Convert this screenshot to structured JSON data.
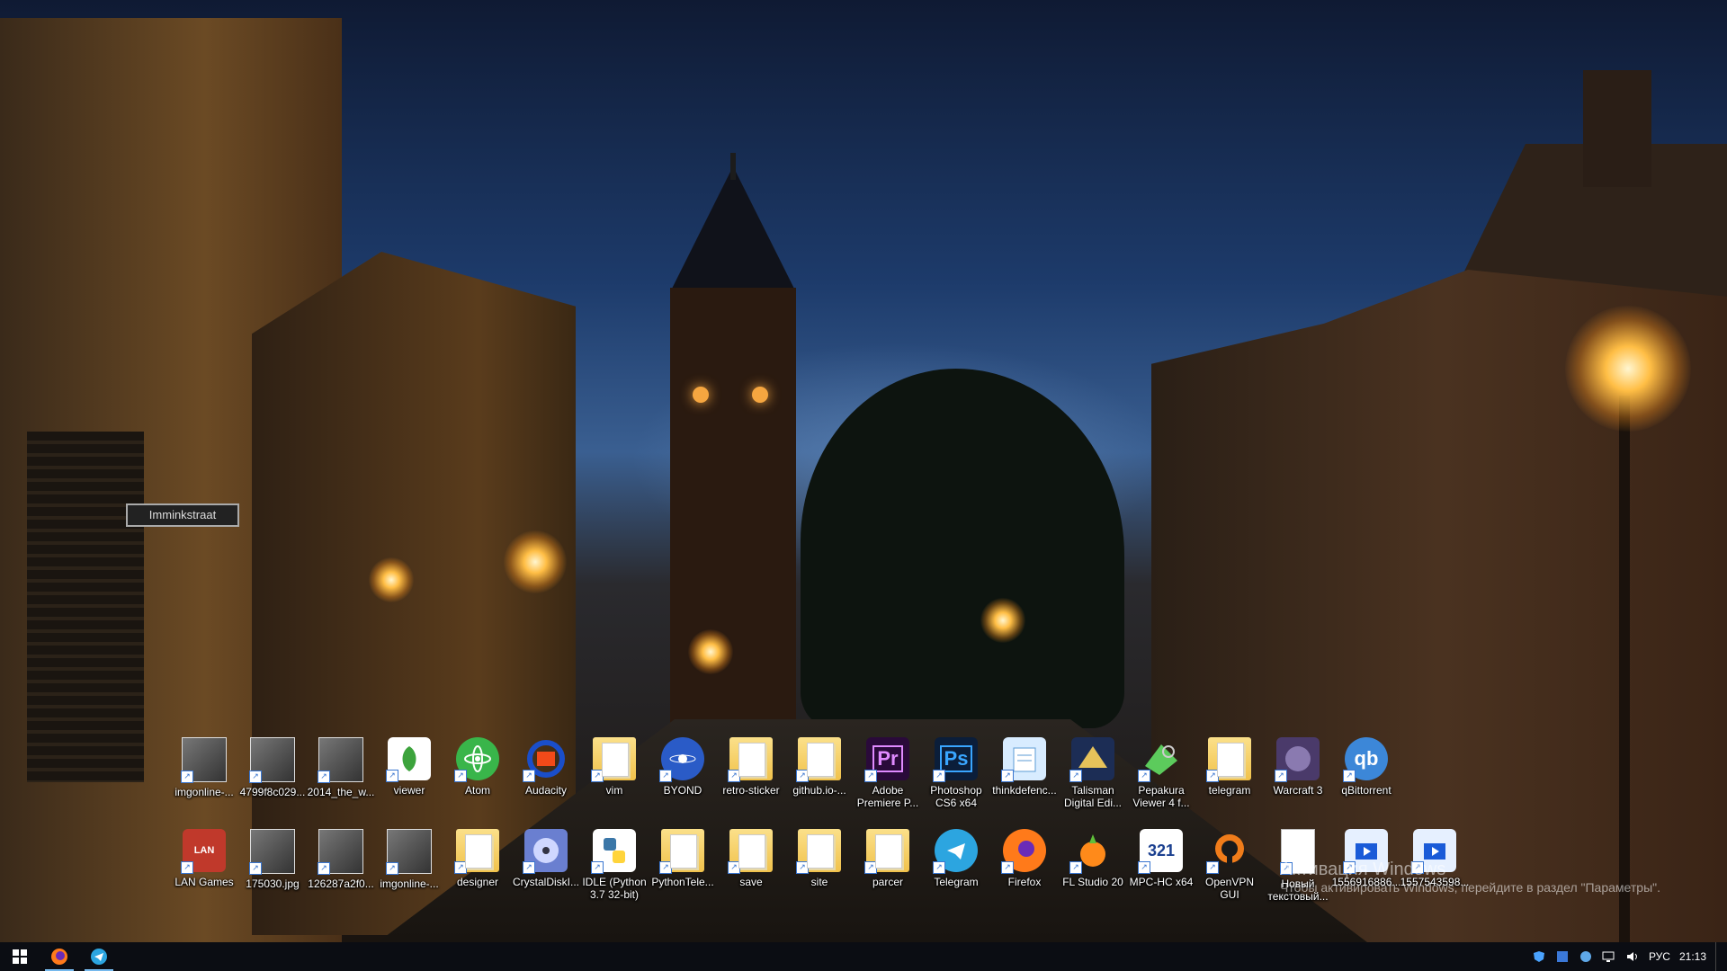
{
  "desktop": {
    "street_sign": "Imminkstraat",
    "row1": [
      {
        "label": "imgonline-...",
        "icon": "photo-icon"
      },
      {
        "label": "4799f8c029...",
        "icon": "photo-icon"
      },
      {
        "label": "2014_the_w...",
        "icon": "photo-icon"
      },
      {
        "label": "viewer",
        "icon": "viewer-app-icon"
      },
      {
        "label": "Atom",
        "icon": "atom-icon"
      },
      {
        "label": "Audacity",
        "icon": "audacity-icon"
      },
      {
        "label": "vim",
        "icon": "folder-icon"
      },
      {
        "label": "BYOND",
        "icon": "byond-icon"
      },
      {
        "label": "retro-sticker",
        "icon": "folder-icon"
      },
      {
        "label": "github.io-...",
        "icon": "folder-icon"
      },
      {
        "label": "Adobe Premiere P...",
        "icon": "premiere-icon"
      },
      {
        "label": "Photoshop CS6 x64",
        "icon": "photoshop-icon"
      },
      {
        "label": "thinkdefenc...",
        "icon": "notepad-icon"
      },
      {
        "label": "Talisman Digital Edi...",
        "icon": "talisman-icon"
      },
      {
        "label": "Pepakura Viewer 4 f...",
        "icon": "pepakura-icon"
      },
      {
        "label": "telegram",
        "icon": "folder-icon"
      },
      {
        "label": "Warcraft 3",
        "icon": "warcraft-icon"
      },
      {
        "label": "qBittorrent",
        "icon": "qbittorrent-icon"
      }
    ],
    "row2": [
      {
        "label": "LAN Games",
        "icon": "lan-icon"
      },
      {
        "label": "175030.jpg",
        "icon": "photo-icon"
      },
      {
        "label": "126287a2f0...",
        "icon": "photo-icon"
      },
      {
        "label": "imgonline-...",
        "icon": "photo-icon"
      },
      {
        "label": "designer",
        "icon": "folder-icon"
      },
      {
        "label": "CrystalDiskI...",
        "icon": "crystaldisk-icon"
      },
      {
        "label": "IDLE (Python 3.7 32-bit)",
        "icon": "python-icon"
      },
      {
        "label": "PythonTele...",
        "icon": "folder-icon"
      },
      {
        "label": "save",
        "icon": "folder-icon"
      },
      {
        "label": "site",
        "icon": "folder-icon"
      },
      {
        "label": "parcer",
        "icon": "folder-icon"
      },
      {
        "label": "Telegram",
        "icon": "telegram-icon"
      },
      {
        "label": "Firefox",
        "icon": "firefox-icon"
      },
      {
        "label": "FL Studio 20",
        "icon": "flstudio-icon"
      },
      {
        "label": "MPC-HC x64",
        "icon": "mpc-icon"
      },
      {
        "label": "OpenVPN GUI",
        "icon": "openvpn-icon"
      },
      {
        "label": "Новый текстовый...",
        "icon": "text-document-icon"
      },
      {
        "label": "1556916886...",
        "icon": "video-file-icon"
      },
      {
        "label": "1557543598...",
        "icon": "video-file-icon"
      }
    ]
  },
  "watermark": {
    "line1": "Активация Windows",
    "line2": "Чтобы активировать Windows, перейдите в раздел \"Параметры\"."
  },
  "taskbar": {
    "language": "РУС",
    "time": "21:13",
    "accent": "#76b9ed"
  }
}
